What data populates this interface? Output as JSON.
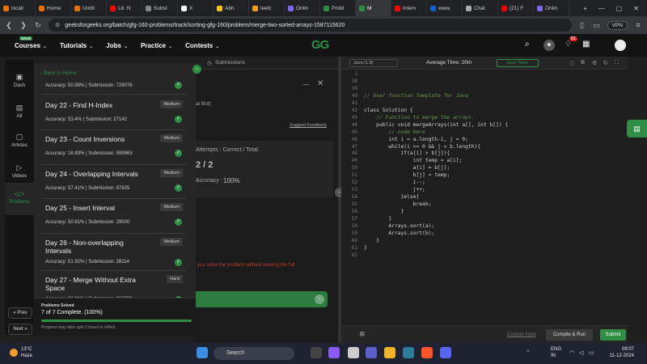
{
  "browser": {
    "tabs": [
      {
        "label": "locall",
        "color": "#e8710a"
      },
      {
        "label": "Home",
        "color": "#e8710a"
      },
      {
        "label": "Untitl",
        "color": "#e8710a"
      },
      {
        "label": "L8. N",
        "color": "#ff0000"
      },
      {
        "label": "Subst",
        "color": "#888888"
      },
      {
        "label": "X",
        "color": "#ffffff"
      },
      {
        "label": "Abh",
        "color": "#f5c518"
      },
      {
        "label": "leetc",
        "color": "#f89f1b"
      },
      {
        "label": "Onlin",
        "color": "#7b68ee"
      },
      {
        "label": "Probl",
        "color": "#2f8d46"
      },
      {
        "label": "M",
        "color": "#2f8d46"
      },
      {
        "label": "Interv",
        "color": "#ff0000"
      },
      {
        "label": "www.",
        "color": "#0a66c2"
      },
      {
        "label": "Chat",
        "color": "#aaaaaa"
      },
      {
        "label": "(21) F",
        "color": "#ff0000"
      },
      {
        "label": "Onlin",
        "color": "#7b68ee"
      }
    ],
    "url": "geeksforgeeks.org/batch/gfg-160-problems/track/sorting-gfg-160/problem/merge-two-sorted-arrays-1587115620",
    "vpn_label": "VPN"
  },
  "gfg_nav": {
    "sale_badge": "SALE",
    "items": [
      "Courses",
      "Tutorials",
      "Jobs",
      "Practice",
      "Contests"
    ],
    "logo": "GG",
    "notification_count": "83"
  },
  "rail": {
    "items": [
      {
        "label": "Dash",
        "icon": "▣"
      },
      {
        "label": "All",
        "icon": "▤"
      },
      {
        "label": "Articles",
        "icon": "▢"
      },
      {
        "label": "Videos",
        "icon": "▷"
      },
      {
        "label": "Problems",
        "icon": "</>"
      }
    ],
    "prev": "« Prev",
    "next": "Next »"
  },
  "problem_list": {
    "back_label": "Back to Home",
    "first_stats": "Accuracy: 50.58% | Submission: 729076",
    "items": [
      {
        "title": "Day 22 - Find H-Index",
        "difficulty": "Medium",
        "stats": "Accuracy: 53.4% | Submission: 27142"
      },
      {
        "title": "Day 23 - Count Inversions",
        "difficulty": "Medium",
        "stats": "Accuracy: 16.93% | Submission: 599963"
      },
      {
        "title": "Day 24 - Overlapping Intervals",
        "difficulty": "Medium",
        "stats": "Accuracy: 57.41% | Submission: 87835"
      },
      {
        "title": "Day 25 - Insert Interval",
        "difficulty": "Medium",
        "stats": "Accuracy: 50.61% | Submission: 29000"
      },
      {
        "title": "Day 26 - Non-overlapping Intervals",
        "difficulty": "Medium",
        "stats": "Accuracy: 51.92% | Submission: 28114"
      },
      {
        "title": "Day 27 - Merge Without Extra Space",
        "difficulty": "Hard",
        "stats": "Accuracy: 32.01% | Submission: 260782"
      }
    ],
    "solved_label": "Problems Solved",
    "solved_value": "7 of 7 Complete. (100%)",
    "solved_fraction": 1.0,
    "solved_note": "Progress may take upto 2 hours to reflect."
  },
  "mid": {
    "submissions_tab": "Submissions",
    "ai_bot": "ai Bot)",
    "suggest_feedback": "Suggest Feedback",
    "attempts_label": "Attempts : Correct / Total",
    "attempts_value": "2 / 2",
    "accuracy_label": "Accuracy :",
    "accuracy_value": "100%",
    "hint_text": "you solve the problem without viewing the full"
  },
  "editor": {
    "language": "Java (1.8)",
    "avg_time": "Average Time: 20m",
    "start_timer": "Start Timer",
    "lines": [
      {
        "n": "1",
        "t": ""
      },
      {
        "n": "38",
        "t": ""
      },
      {
        "n": "39",
        "t": ""
      },
      {
        "n": "40",
        "t": "// User function Template for Java",
        "c": "cm"
      },
      {
        "n": "41",
        "t": ""
      },
      {
        "n": "42",
        "t": "class Solution {"
      },
      {
        "n": "43",
        "t": "    // Function to merge the arrays.",
        "c": "cm"
      },
      {
        "n": "44",
        "t": "    public void mergeArrays(int a[], int b[]) {"
      },
      {
        "n": "45",
        "t": "        // code here",
        "c": "cm"
      },
      {
        "n": "46",
        "t": "        int i = a.length-1, j = 0;"
      },
      {
        "n": "47",
        "t": "        while(i >= 0 && j < b.length){"
      },
      {
        "n": "48",
        "t": "            if(a[i] > b[j]){"
      },
      {
        "n": "49",
        "t": "                int temp = a[i];"
      },
      {
        "n": "50",
        "t": "                a[i] = b[j];"
      },
      {
        "n": "51",
        "t": "                b[j] = temp;"
      },
      {
        "n": "52",
        "t": "                i--;"
      },
      {
        "n": "53",
        "t": "                j++;"
      },
      {
        "n": "54",
        "t": "            }else{"
      },
      {
        "n": "55",
        "t": "                break;"
      },
      {
        "n": "56",
        "t": "            }"
      },
      {
        "n": "57",
        "t": "        }"
      },
      {
        "n": "58",
        "t": "        Arrays.sort(a);"
      },
      {
        "n": "59",
        "t": "        Arrays.sort(b);"
      },
      {
        "n": "60",
        "t": "    }"
      },
      {
        "n": "61",
        "t": "}"
      },
      {
        "n": "62",
        "t": ""
      }
    ],
    "custom_input": "Custom Input",
    "compile_run": "Compile & Run",
    "submit": "Submit"
  },
  "taskbar": {
    "weather_temp": "13°C",
    "weather_text": "Haze",
    "search": "Search",
    "lang_1": "ENG",
    "lang_2": "IN",
    "time": "09:07",
    "date": "11-12-2024"
  }
}
